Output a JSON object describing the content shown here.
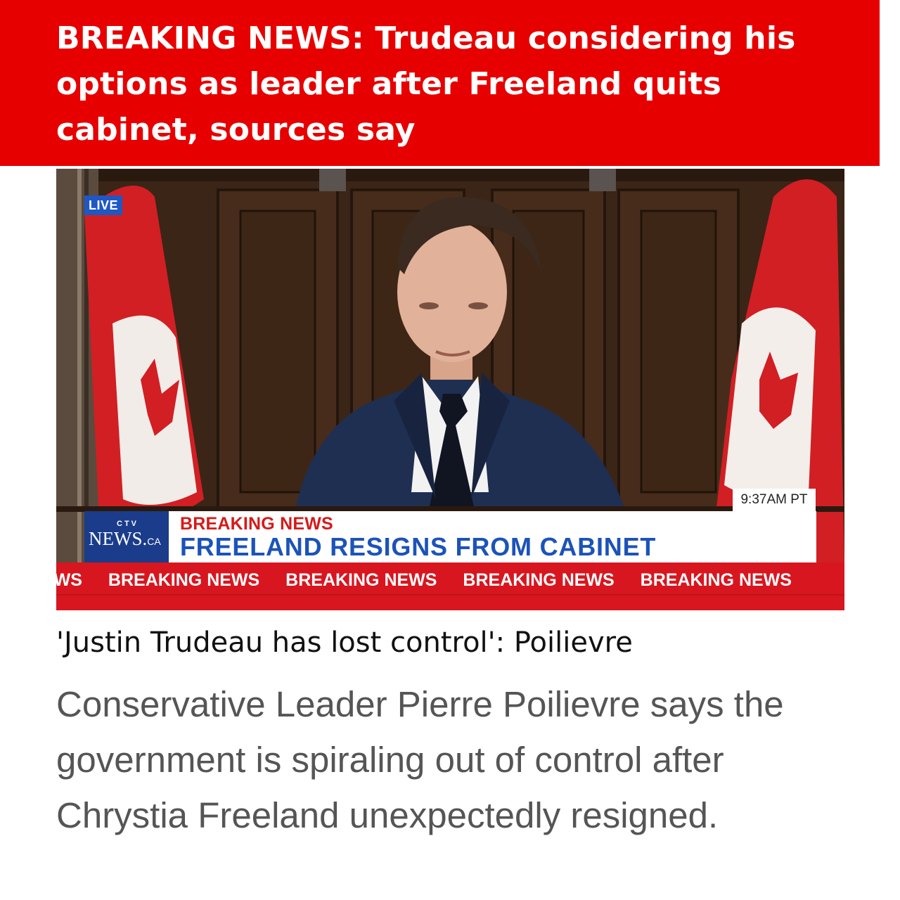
{
  "banner": {
    "headline": "BREAKING NEWS: Trudeau considering his options as leader after Freeland quits cabinet, sources say"
  },
  "video": {
    "live_badge": "LIVE",
    "clock": "9:37AM PT",
    "logo": {
      "network": "CTV",
      "site": "NEWS.",
      "site_suffix": "CA"
    },
    "lower_third": {
      "kicker": "BREAKING NEWS",
      "headline": "FREELAND RESIGNS FROM CABINET"
    },
    "ticker": [
      "EWS",
      "BREAKING NEWS",
      "BREAKING NEWS",
      "BREAKING NEWS",
      "BREAKING NEWS"
    ]
  },
  "article": {
    "title": "'Justin Trudeau has lost control': Poilievre",
    "body": "Conservative Leader Pierre Poilievre says the government is spiraling out of control after Chrystia Freeland unexpectedly resigned."
  },
  "colors": {
    "banner_red": "#e60000",
    "ticker_red": "#d8161f",
    "ctv_blue": "#1a3c8a",
    "headline_blue": "#1c53b8"
  }
}
